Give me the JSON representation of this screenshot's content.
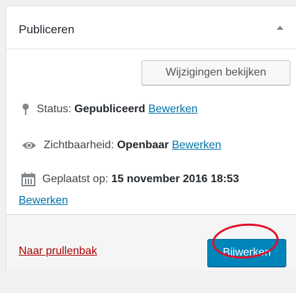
{
  "panel": {
    "title": "Publiceren"
  },
  "preview_button": {
    "label": "Wijzigingen bekijken"
  },
  "status": {
    "label": "Status: ",
    "value": "Gepubliceerd",
    "edit_link": "Bewerken"
  },
  "visibility": {
    "label": "Zichtbaarheid: ",
    "value": "Openbaar",
    "edit_link": "Bewerken"
  },
  "published": {
    "label": "Geplaatst op: ",
    "value": "15 november 2016 18:53",
    "edit_link": "Bewerken"
  },
  "footer": {
    "trash_link": "Naar prullenbak",
    "update_button": "Bijwerken"
  },
  "colors": {
    "link": "#0073aa",
    "trash": "#aa0000",
    "primary_button": "#0085ba",
    "annotation": "#e0102a"
  },
  "icons": {
    "toggle": "triangle-up-icon",
    "status": "pin-icon",
    "visibility": "eye-icon",
    "date": "calendar-icon"
  }
}
